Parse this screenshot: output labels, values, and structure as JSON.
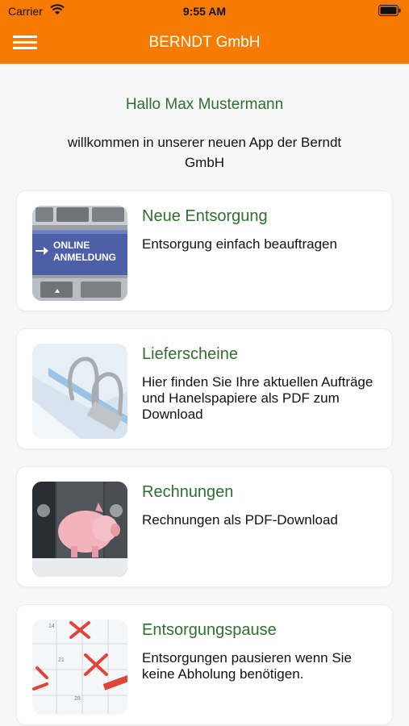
{
  "status_bar": {
    "carrier": "Carrier",
    "time": "9:55 AM"
  },
  "nav": {
    "title": "BERNDT GmbH"
  },
  "greeting": "Hallo Max Mustermann",
  "welcome": "willkommen in unserer neuen App der Berndt GmbH",
  "cards": [
    {
      "title": "Neue Entsorgung",
      "description": "Entsorgung einfach beauftragen",
      "image_text": "ONLINE ANMELDUNG"
    },
    {
      "title": "Lieferscheine",
      "description": "Hier finden Sie Ihre aktuellen Aufträge und Hanelspapiere als PDF zum Download"
    },
    {
      "title": "Rechnungen",
      "description": "Rechnungen als PDF-Download"
    },
    {
      "title": "Entsorgungspause",
      "description": "Entsorgungen pausieren wenn Sie keine Abholung benötigen.",
      "calendar_numbers": [
        "14",
        "21",
        "28"
      ]
    }
  ],
  "colors": {
    "header": "#f77b00",
    "accent_green": "#2f6f2f",
    "background": "#f7f7f7"
  }
}
